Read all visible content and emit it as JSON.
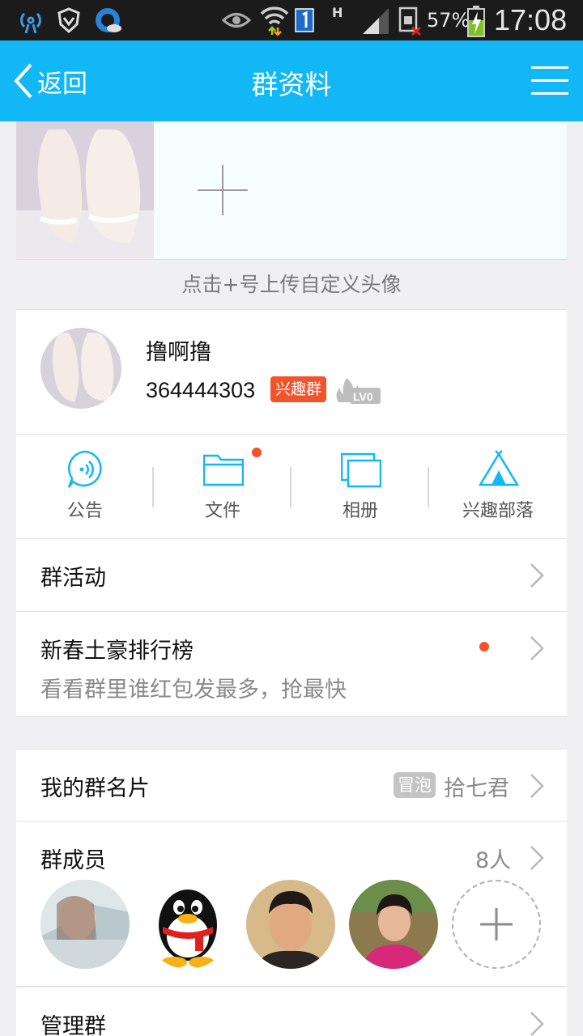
{
  "status_bar": {
    "battery_percent": "57%",
    "time": "17:08",
    "network_label": "H"
  },
  "nav": {
    "back_label": "返回",
    "title": "群资料"
  },
  "avatar_strip": {
    "upload_hint": "点击+号上传自定义头像"
  },
  "group": {
    "name": "撸啊撸",
    "number": "364444303",
    "type_badge": "兴趣群",
    "level": "LV0"
  },
  "quick_actions": [
    {
      "label": "公告",
      "icon": "announcement-icon"
    },
    {
      "label": "文件",
      "icon": "folder-icon",
      "has_dot": true
    },
    {
      "label": "相册",
      "icon": "album-icon"
    },
    {
      "label": "兴趣部落",
      "icon": "tribe-tent-icon"
    }
  ],
  "rows": {
    "activity": {
      "title": "群活动"
    },
    "ranking": {
      "title": "新春土豪排行榜",
      "subtitle": "看看群里谁红包发最多，抢最快"
    },
    "card": {
      "title": "我的群名片",
      "tag": "冒泡",
      "value": "拾七君"
    },
    "members": {
      "title": "群成员",
      "count": "8人"
    },
    "manage": {
      "title": "管理群"
    }
  },
  "colors": {
    "nav_blue": "#12b7f5",
    "accent_red": "#f0542d",
    "text_gray": "#8a8a8a"
  }
}
